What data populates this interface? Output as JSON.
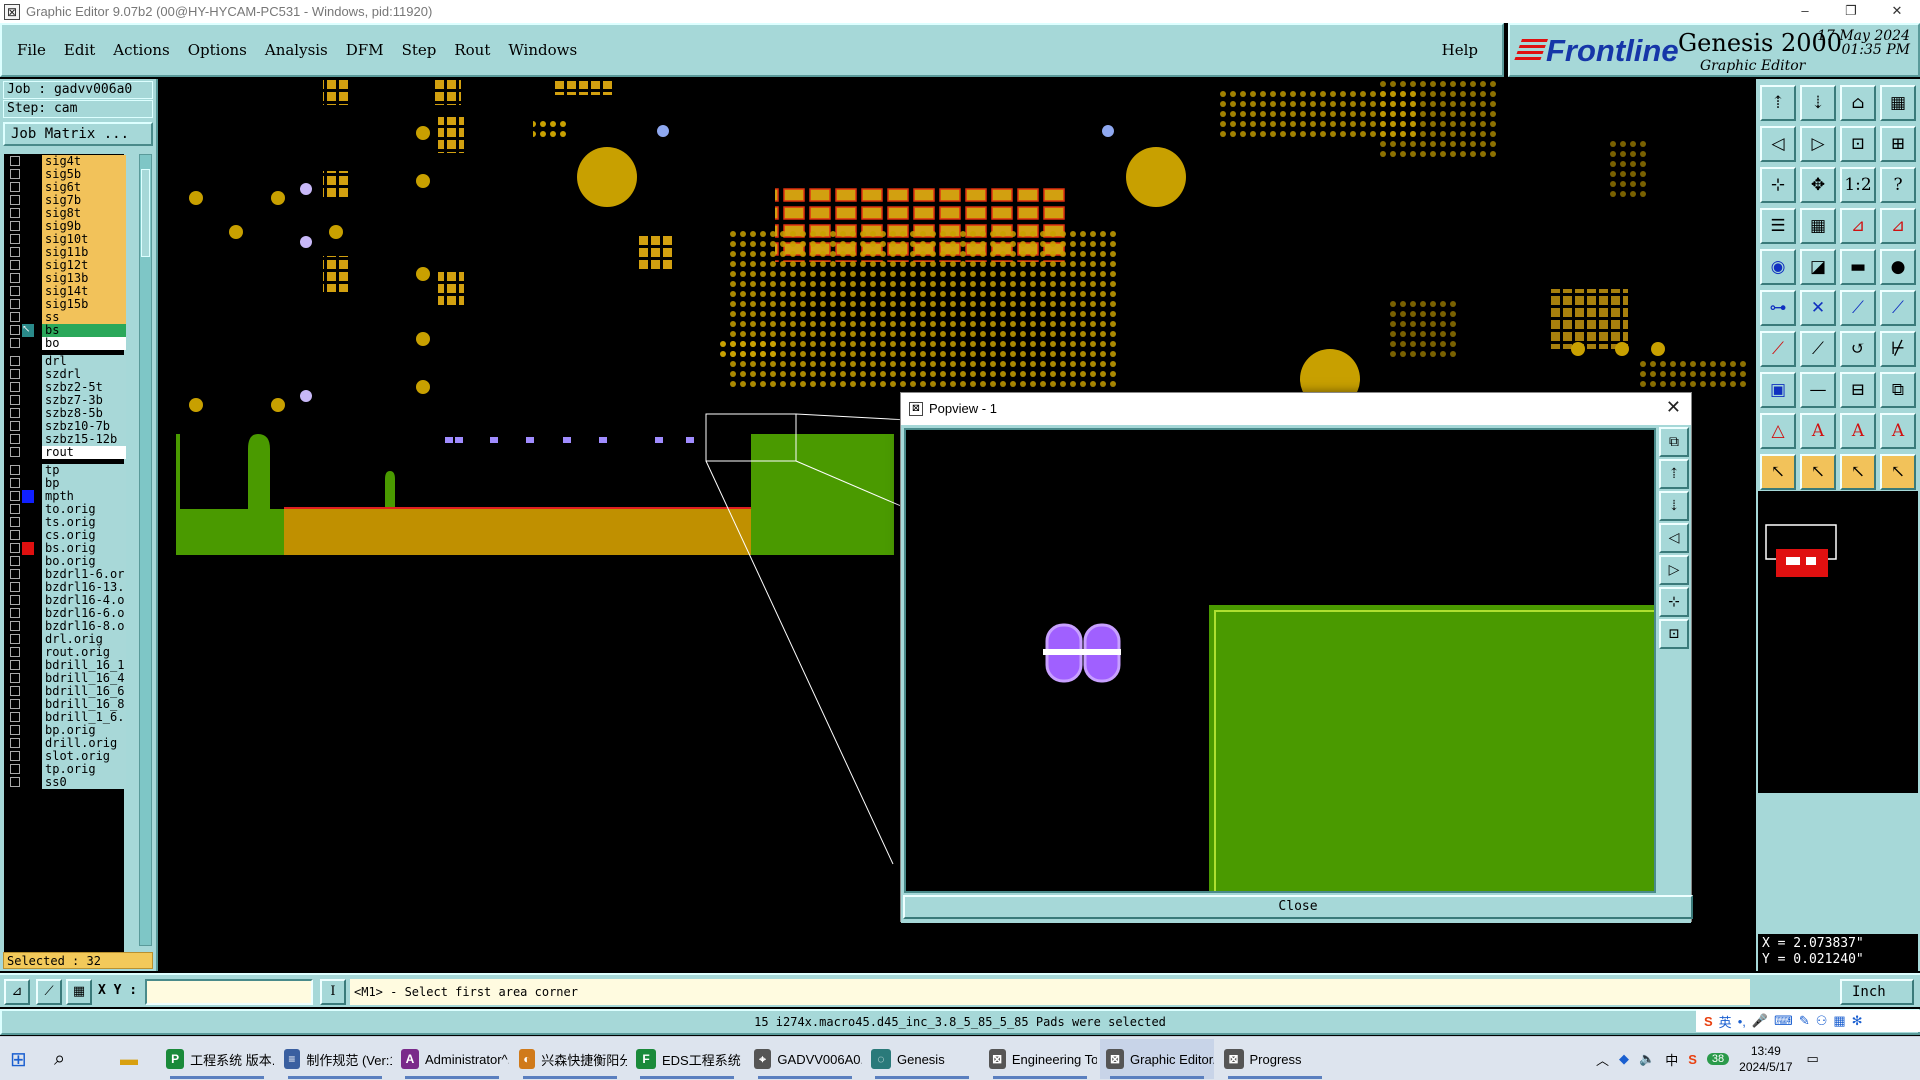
{
  "window": {
    "title": "Graphic Editor 9.07b2 (00@HY-HYCAM-PC531 - Windows, pid:11920)",
    "controls": [
      "–",
      "❐",
      "✕"
    ]
  },
  "menu": {
    "items": [
      "File",
      "Edit",
      "Actions",
      "Options",
      "Analysis",
      "DFM",
      "Step",
      "Rout",
      "Windows"
    ],
    "help": "Help"
  },
  "brand": {
    "logo": "Frontline",
    "product": "Genesis 2000",
    "subtitle": "Graphic Editor",
    "date": "17 May 2024",
    "time": "01:35 PM"
  },
  "job": {
    "job_label": "Job : gadvv006a0",
    "step_label": "Step: cam",
    "job_matrix_button": "Job Matrix ..."
  },
  "layers": [
    {
      "name": "sig4t",
      "color": "#f2c25a",
      "mark": ""
    },
    {
      "name": "sig5b",
      "color": "#f2c25a",
      "mark": ""
    },
    {
      "name": "sig6t",
      "color": "#f2c25a",
      "mark": ""
    },
    {
      "name": "sig7b",
      "color": "#f2c25a",
      "mark": ""
    },
    {
      "name": "sig8t",
      "color": "#f2c25a",
      "mark": ""
    },
    {
      "name": "sig9b",
      "color": "#f2c25a",
      "mark": ""
    },
    {
      "name": "sig10t",
      "color": "#f2c25a",
      "mark": ""
    },
    {
      "name": "sig11b",
      "color": "#f2c25a",
      "mark": ""
    },
    {
      "name": "sig12t",
      "color": "#f2c25a",
      "mark": ""
    },
    {
      "name": "sig13b",
      "color": "#f2c25a",
      "mark": ""
    },
    {
      "name": "sig14t",
      "color": "#f2c25a",
      "mark": ""
    },
    {
      "name": "sig15b",
      "color": "#f2c25a",
      "mark": ""
    },
    {
      "name": "ss",
      "color": "#f2c25a",
      "mark": ""
    },
    {
      "name": "bs",
      "color": "#2aa85a",
      "mark": "work"
    },
    {
      "name": "bo",
      "color": "#ffffff",
      "mark": ""
    },
    {
      "name": "drl",
      "color": "#a8d8d8",
      "mark": "",
      "gap": true
    },
    {
      "name": "szdrl",
      "color": "#a8d8d8",
      "mark": ""
    },
    {
      "name": "szbz2-5t",
      "color": "#a8d8d8",
      "mark": ""
    },
    {
      "name": "szbz7-3b",
      "color": "#a8d8d8",
      "mark": ""
    },
    {
      "name": "szbz8-5b",
      "color": "#a8d8d8",
      "mark": ""
    },
    {
      "name": "szbz10-7b",
      "color": "#a8d8d8",
      "mark": ""
    },
    {
      "name": "szbz15-12b",
      "color": "#a8d8d8",
      "mark": ""
    },
    {
      "name": "rout",
      "color": "#ffffff",
      "mark": ""
    },
    {
      "name": "tp",
      "color": "#a8d8d8",
      "mark": "",
      "gap": true
    },
    {
      "name": "bp",
      "color": "#a8d8d8",
      "mark": ""
    },
    {
      "name": "mpth",
      "color": "#a8d8d8",
      "mark": "blue"
    },
    {
      "name": "to.orig",
      "color": "#a8d8d8",
      "mark": ""
    },
    {
      "name": "ts.orig",
      "color": "#a8d8d8",
      "mark": ""
    },
    {
      "name": "cs.orig",
      "color": "#a8d8d8",
      "mark": ""
    },
    {
      "name": "bs.orig",
      "color": "#a8d8d8",
      "mark": "red"
    },
    {
      "name": "bo.orig",
      "color": "#a8d8d8",
      "mark": ""
    },
    {
      "name": "bzdrl1-6.or",
      "color": "#a8d8d8",
      "mark": ""
    },
    {
      "name": "bzdrl16-13.",
      "color": "#a8d8d8",
      "mark": ""
    },
    {
      "name": "bzdrl16-4.o",
      "color": "#a8d8d8",
      "mark": ""
    },
    {
      "name": "bzdrl16-6.o",
      "color": "#a8d8d8",
      "mark": ""
    },
    {
      "name": "bzdrl16-8.o",
      "color": "#a8d8d8",
      "mark": ""
    },
    {
      "name": "drl.orig",
      "color": "#a8d8d8",
      "mark": ""
    },
    {
      "name": "rout.orig",
      "color": "#a8d8d8",
      "mark": ""
    },
    {
      "name": "bdrill_16_1",
      "color": "#a8d8d8",
      "mark": ""
    },
    {
      "name": "bdrill_16_4",
      "color": "#a8d8d8",
      "mark": ""
    },
    {
      "name": "bdrill_16_6",
      "color": "#a8d8d8",
      "mark": ""
    },
    {
      "name": "bdrill_16_8",
      "color": "#a8d8d8",
      "mark": ""
    },
    {
      "name": "bdrill_1_6.",
      "color": "#a8d8d8",
      "mark": ""
    },
    {
      "name": "bp.orig",
      "color": "#a8d8d8",
      "mark": ""
    },
    {
      "name": "drill.orig",
      "color": "#a8d8d8",
      "mark": ""
    },
    {
      "name": "slot.orig",
      "color": "#a8d8d8",
      "mark": ""
    },
    {
      "name": "tp.orig",
      "color": "#a8d8d8",
      "mark": ""
    },
    {
      "name": "ss0",
      "color": "#a8d8d8",
      "mark": ""
    }
  ],
  "selected_label": "Selected : 32",
  "toolbar": {
    "icons": [
      "home-top-icon",
      "home-bottom-icon",
      "house-icon",
      "window-icon",
      "zoom-left-icon",
      "zoom-right-icon",
      "zoom-fit-icon",
      "zoom-home-icon",
      "fit-window-icon",
      "move-icon",
      "scale-1-2-icon",
      "help-query-icon",
      "layers-icon",
      "grid-icon",
      "snap-red-icon",
      "snap-red2-icon",
      "pad-icon",
      "surface-icon",
      "ruler-icon",
      "circle-icon",
      "node-icon",
      "cross-icon",
      "line-node-icon",
      "line-node2-icon",
      "line-red-icon",
      "line-blue-icon",
      "arc-icon",
      "line-split-icon",
      "square-red-icon",
      "line-dash-icon",
      "measure-icon",
      "drag-icon",
      "triangle-icon",
      "text-a-icon",
      "text-a2-icon",
      "text-a3-icon",
      "pointer-icon",
      "pointer2-icon",
      "pointer3-icon",
      "pointer4-icon"
    ],
    "glyphs": [
      "⇡",
      "⇣",
      "⌂",
      "▦",
      "◁",
      "▷",
      "⊡",
      "⊞",
      "⊹",
      "✥",
      "1:2",
      "?",
      "☰",
      "▦",
      "⊿",
      "⊿",
      "◉",
      "◪",
      "▬",
      "●",
      "⊶",
      "✕",
      "⟋",
      "⟋",
      "⟋",
      "⟋",
      "↺",
      "⊬",
      "▣",
      "—",
      "⊟",
      "⧉",
      "△",
      "A",
      "A",
      "A",
      "↖",
      "↖",
      "↖",
      "↖"
    ]
  },
  "coords": {
    "x": "X = 2.073837\"",
    "y": "Y = 0.021240\""
  },
  "bottombar": {
    "xy_label": "X Y :",
    "xy_value": "",
    "prompt": "<M1> - Select first area corner",
    "units": "Inch"
  },
  "status": "15 i274x.macro45.d45_inc_3.8_5_85_5_85 Pads were selected",
  "popview": {
    "title": "Popview - 1",
    "close": "✕",
    "close_button": "Close"
  },
  "taskbar": {
    "items": [
      {
        "label": "工程系统  版本...",
        "icon": "P",
        "color": "#1a8a3a"
      },
      {
        "label": "制作规范 (Ver:1...",
        "icon": "≡",
        "color": "#3a5fa0"
      },
      {
        "label": "Administrator^...",
        "icon": "A",
        "color": "#7a2a8a"
      },
      {
        "label": "兴森快捷衡阳分...",
        "icon": "◐",
        "color": "#d07a1a"
      },
      {
        "label": "EDS工程系统",
        "icon": "F",
        "color": "#1a8a3a"
      },
      {
        "label": "GADVV006A0...",
        "icon": "⌖",
        "color": "#555"
      },
      {
        "label": "Genesis",
        "icon": "◌",
        "color": "#2a7a7a"
      },
      {
        "label": "Engineering To...",
        "icon": "⊠",
        "color": "#555"
      },
      {
        "label": "Graphic Editor...",
        "icon": "⊠",
        "color": "#555"
      },
      {
        "label": "Progress",
        "icon": "⊠",
        "color": "#555"
      }
    ],
    "tray": {
      "lang": "中",
      "badge": "38",
      "time": "13:49",
      "date": "2024/5/17"
    }
  },
  "ime": {
    "mode": "英"
  }
}
